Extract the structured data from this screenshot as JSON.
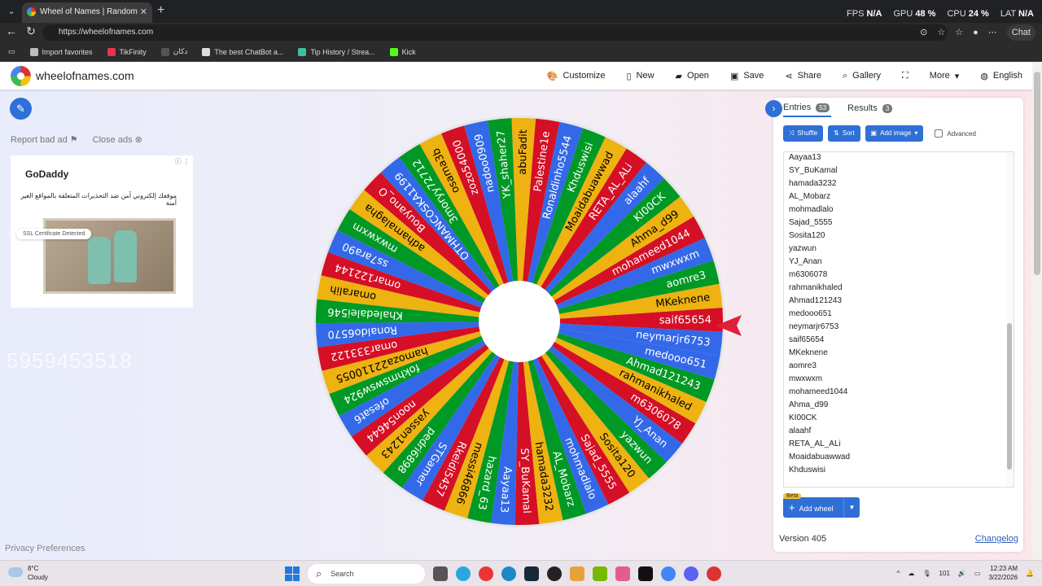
{
  "browser": {
    "tab_title": "Wheel of Names | Random name p",
    "url": "https://wheelofnames.com",
    "perf": [
      {
        "label": "FPS",
        "value": "N/A"
      },
      {
        "label": "GPU",
        "value": "48 %"
      },
      {
        "label": "CPU",
        "value": "24 %"
      },
      {
        "label": "LAT",
        "value": "N/A"
      }
    ],
    "chat_label": "Chat",
    "bookmarks": [
      {
        "label": "Import favorites",
        "color": "#bbbbbb"
      },
      {
        "label": "TikFinity",
        "color": "#e8344e"
      },
      {
        "label": "دكان",
        "color": "#555555"
      },
      {
        "label": "The best ChatBot a...",
        "color": "#dddddd"
      },
      {
        "label": "Tip History / Strea...",
        "color": "#3fbfa0"
      },
      {
        "label": "Kick",
        "color": "#53fc18"
      }
    ]
  },
  "app": {
    "site_name": "wheelofnames.com",
    "menu": [
      "Customize",
      "New",
      "Open",
      "Save",
      "Share",
      "Gallery",
      "",
      "More",
      "English"
    ],
    "report_ad": "Report bad ad",
    "close_ads": "Close ads",
    "privacy": "Privacy Preferences",
    "overlay_number": "5959453518"
  },
  "ad": {
    "brand": "GoDaddy",
    "text": "موقعك إلكتروني آمن ضد التحذيرات المتعلقة بالمواقع الغير آمنة",
    "ssl_label": "SSL Certificate Detected"
  },
  "wheel": {
    "colors": [
      "#3369e8",
      "#d50f25",
      "#eeb211",
      "#009925"
    ],
    "segments": [
      "neymarjr6753",
      "saif65654",
      "MKeknene",
      "aomre3",
      "mwxwxm",
      "mohameed1044",
      "Ahma_d99",
      "KI00CK",
      "alaahf",
      "RETA_AL_ALi",
      "Moaidabuawwad",
      "Khduswisi",
      "Ronaldinho5544",
      "Palestine1e",
      "abuFadit",
      "YK_shaher27",
      "nadoo0909",
      "zozo54000",
      "osama3b",
      "3moryy72712",
      "OTHMANCOSKA1199",
      "Bouyano_O",
      "adhamalagha",
      "mwxwxm",
      "ss7ara90",
      "omar122144",
      "omaralih",
      "Khaledalei546",
      "Ronaldo6570",
      "omar333122",
      "hamoza22110055",
      "fokhmswsw924",
      "ofesat6",
      "noon54644",
      "yassen1243",
      "pedri6898",
      "STGamer",
      "Rkeidi5457",
      "messi46866",
      "hazard_63",
      "Aayaa13",
      "SY_BuKamal",
      "hamada3232",
      "AL_Mobarz",
      "mohmadlalo",
      "Sajad_5555",
      "Sosita120",
      "yazwun",
      "YJ_Anan",
      "m6306078",
      "rahmanikhaled",
      "Ahmad121243",
      "medooo651"
    ]
  },
  "panel": {
    "tab_entries": "Entries",
    "entries_count": "53",
    "tab_results": "Results",
    "results_count": "3",
    "shuffle": "Shuffle",
    "sort": "Sort",
    "add_image": "Add image",
    "advanced": "Advanced",
    "entries": [
      "Aayaa13",
      "SY_BuKamal",
      "hamada3232",
      "AL_Mobarz",
      "mohmadlalo",
      "Sajad_5555",
      "Sosita120",
      "yazwun",
      "YJ_Anan",
      "m6306078",
      "rahmanikhaled",
      "Ahmad121243",
      "medooo651",
      "neymarjr6753",
      "saif65654",
      "MKeknene",
      "aomre3",
      "mwxwxm",
      "mohameed1044",
      "Ahma_d99",
      "KI00CK",
      "alaahf",
      "RETA_AL_ALi",
      "Moaidabuawwad",
      "Khduswisi"
    ],
    "beta": "Beta",
    "add_wheel": "Add wheel",
    "version": "Version 405",
    "changelog": "Changelog"
  },
  "taskbar": {
    "temp": "8°C",
    "condition": "Cloudy",
    "search": "Search",
    "time": "12:23 AM",
    "date": "3/22/2026",
    "tray_num": "101"
  }
}
